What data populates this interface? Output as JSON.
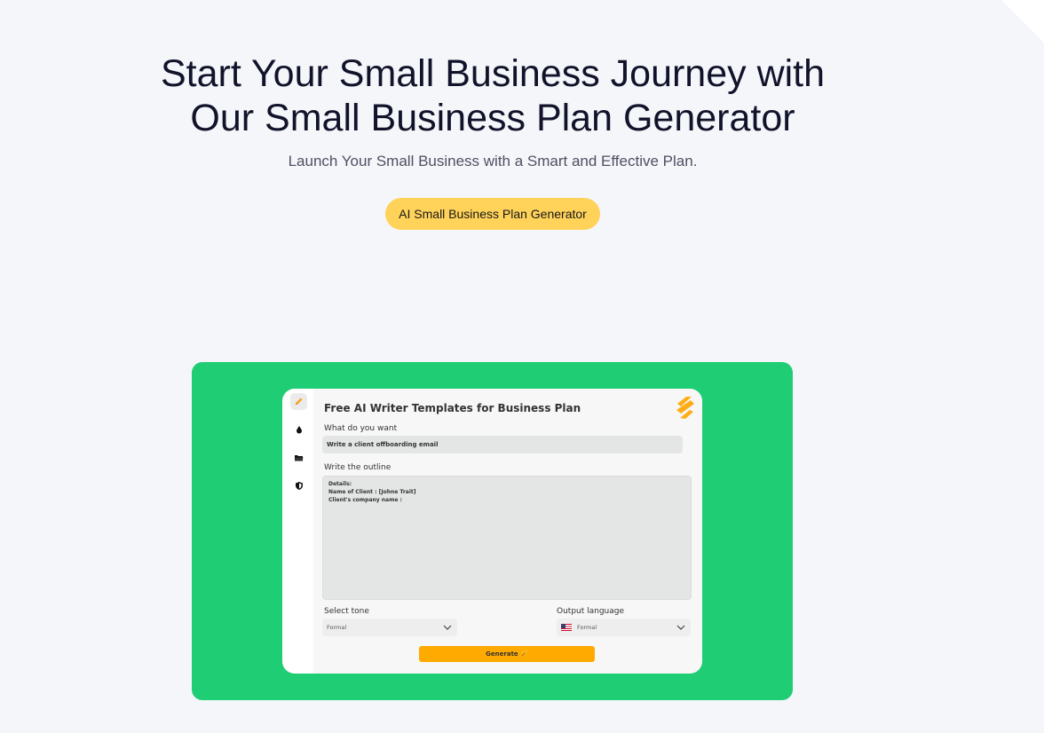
{
  "hero": {
    "title": "Start Your Small Business Journey with Our Small Business Plan Generator",
    "subtitle": "Launch Your Small Business with a Smart and Effective Plan.",
    "cta_label": "AI Small Business Plan Generator"
  },
  "colors": {
    "page_bg": "#f5f6fa",
    "cta_bg": "#ffd25a",
    "panel_bg": "#1fcd75",
    "generate_bg": "#ffaa00",
    "logo_orange": "#ffad17"
  },
  "app": {
    "title": "Free AI Writer Templates for Business Plan",
    "sidebar_icons": [
      "pencil-icon",
      "drop-icon",
      "folder-icon",
      "shield-icon"
    ],
    "want_label": "What do you want",
    "want_value": "Write a client offboarding email",
    "outline_label": "Write the outline",
    "outline_lines": [
      "Details:",
      "Name of Client : [Johne Trait]",
      "Client's company name :"
    ],
    "tone_label": "Select tone",
    "tone_value": "Formal",
    "language_label": "Output language",
    "language_value": "Formal",
    "generate_label": "Generate 🪄"
  }
}
